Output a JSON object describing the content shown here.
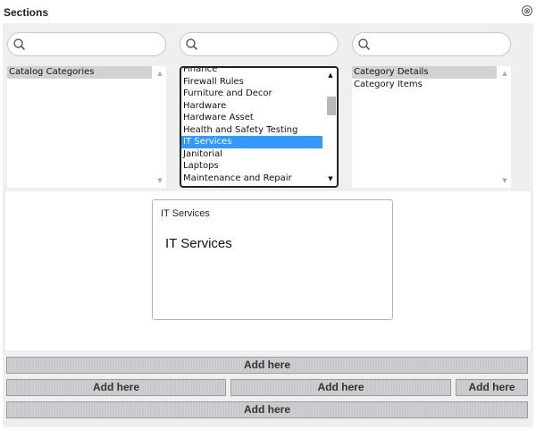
{
  "header": {
    "title": "Sections",
    "close_glyph": "⊗",
    "close_icon": "circle-x-icon"
  },
  "search": {
    "placeholder": "",
    "icon": "search-icon"
  },
  "lists": {
    "catalog": {
      "items": [
        "Catalog Categories"
      ],
      "selected": "Catalog Categories"
    },
    "categories": {
      "items": [
        "Finance",
        "Firewall Rules",
        "Furniture and Decor",
        "Hardware",
        "Hardware Asset",
        "Health and Safety Testing",
        "IT Services",
        "Janitorial",
        "Laptops",
        "Maintenance and Repair"
      ],
      "selected": "IT Services"
    },
    "details": {
      "items": [
        "Category Details",
        "Category Items"
      ],
      "selected": "Category Details"
    }
  },
  "preview": {
    "small_title": "IT Services",
    "large_title": "IT Services"
  },
  "add_here": {
    "label": "Add here"
  },
  "colors": {
    "selection_blue": "#3399ff",
    "selection_grey": "#d2d2d2",
    "panel_bg": "#efefef"
  }
}
